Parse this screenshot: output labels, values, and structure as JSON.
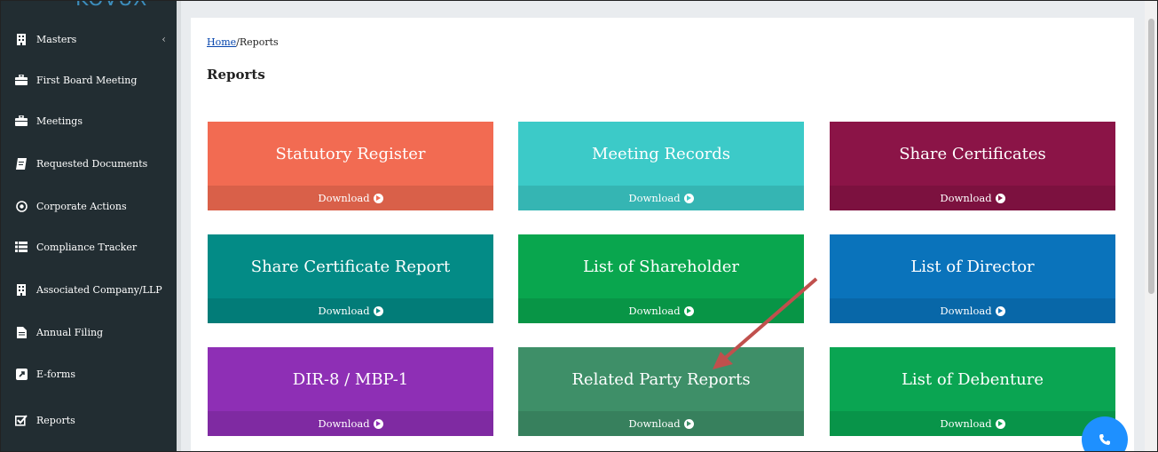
{
  "sidebar": {
    "logo": "KOVUX",
    "items": [
      {
        "label": "Masters",
        "icon": "building-icon"
      },
      {
        "label": "First Board Meeting",
        "icon": "briefcase-icon"
      },
      {
        "label": "Meetings",
        "icon": "briefcase-icon"
      },
      {
        "label": "Requested Documents",
        "icon": "document-icon"
      },
      {
        "label": "Corporate Actions",
        "icon": "target-icon"
      },
      {
        "label": "Compliance Tracker",
        "icon": "list-icon"
      },
      {
        "label": "Associated Company/LLP",
        "icon": "building-icon"
      },
      {
        "label": "Annual Filing",
        "icon": "file-icon"
      },
      {
        "label": "E-forms",
        "icon": "external-link-icon"
      },
      {
        "label": "Reports",
        "icon": "checkbox-icon"
      }
    ],
    "collapse_chevron": "‹"
  },
  "breadcrumb": {
    "home": "Home",
    "current": "/Reports"
  },
  "page": {
    "title": "Reports"
  },
  "tiles": [
    {
      "title": "Statutory Register",
      "download": "Download",
      "color": "#f26b52"
    },
    {
      "title": "Meeting Records",
      "download": "Download",
      "color": "#3ccac8"
    },
    {
      "title": "Share Certificates",
      "download": "Download",
      "color": "#8b1447"
    },
    {
      "title": "Share Certificate Report",
      "download": "Download",
      "color": "#038b86"
    },
    {
      "title": "List of Shareholder",
      "download": "Download",
      "color": "#09a64e"
    },
    {
      "title": "List of Director",
      "download": "Download",
      "color": "#0a73bb"
    },
    {
      "title": "DIR-8 / MBP-1",
      "download": "Download",
      "color": "#8e2fb5"
    },
    {
      "title": "Related Party Reports",
      "download": "Download",
      "color": "#3e8f68"
    },
    {
      "title": "List of Debenture",
      "download": "Download",
      "color": "#0aa552"
    }
  ],
  "annotation": {
    "color": "#c0504d"
  },
  "call_button": {
    "color": "#1e90ff"
  }
}
